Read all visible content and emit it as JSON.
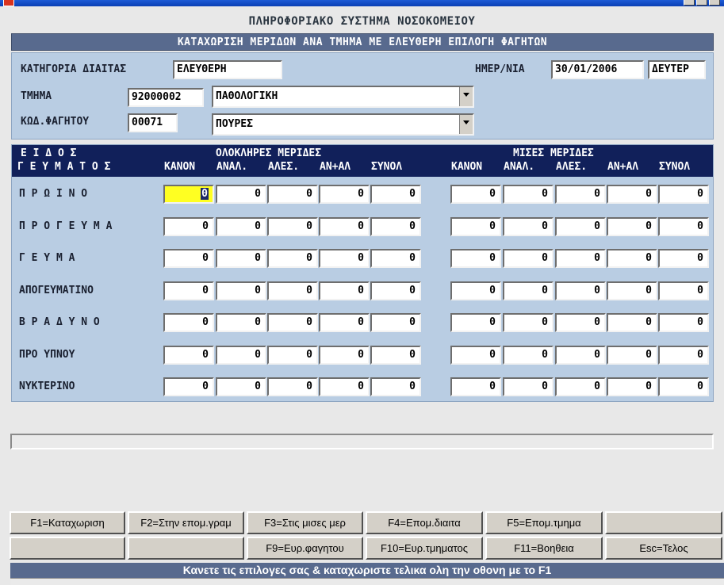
{
  "window": {
    "title": ""
  },
  "system_title": "ΠΛΗΡΟΦΟΡΙΑΚΟ ΣΥΣΤΗΜΑ ΝΟΣΟΚΟΜΕΙΟΥ",
  "form_title": "ΚΑΤΑΧΩΡΙΣΗ ΜΕΡΙΔΩΝ ΑΝΑ ΤΜΗΜΑ ΜΕ ΕΛΕΥΘΕΡΗ ΕΠΙΛΟΓΗ ΦΑΓΗΤΩΝ",
  "filters": {
    "diet_label": "ΚΑΤΗΓΟΡΙΑ ΔΙΑΙΤΑΣ",
    "diet_value": "ΕΛΕΥΘΕΡΗ",
    "date_label": "ΗΜΕΡ/ΝΙΑ",
    "date_value": "30/01/2006",
    "day_value": "ΔΕΥΤΕΡ",
    "dept_label": "ΤΜΗΜΑ",
    "dept_code": "92000002",
    "dept_name": "ΠΑΘΟΛΟΓΙΚΗ",
    "food_label": "ΚΩΔ.ΦΑΓΗΤΟΥ",
    "food_code": "00071",
    "food_name": "ΠΟΥΡΕΣ"
  },
  "grid": {
    "type_header_1": "Ε  Ι  Δ  Ο  Σ",
    "type_header_2": "Γ Ε Υ Μ Α Τ Ο Σ",
    "full_group": "ΟΛΟΚΛΗΡΕΣ  ΜΕΡΙΔΕΣ",
    "half_group": "ΜΙΣΕΣ  ΜΕΡΙΔΕΣ",
    "columns": [
      "ΚΑΝΟΝ",
      "ΑΝΑΛ.",
      "ΑΛΕΣ.",
      "ΑΝ+ΑΛ",
      "ΣΥΝΟΛ"
    ],
    "rows": [
      {
        "label": "Π Ρ Ω Ι Ν Ο",
        "full": [
          "0",
          "0",
          "0",
          "0",
          "0"
        ],
        "half": [
          "0",
          "0",
          "0",
          "0",
          "0"
        ]
      },
      {
        "label": "Π Ρ Ο Γ Ε Υ Μ Α",
        "full": [
          "0",
          "0",
          "0",
          "0",
          "0"
        ],
        "half": [
          "0",
          "0",
          "0",
          "0",
          "0"
        ]
      },
      {
        "label": "Γ Ε Υ Μ Α",
        "full": [
          "0",
          "0",
          "0",
          "0",
          "0"
        ],
        "half": [
          "0",
          "0",
          "0",
          "0",
          "0"
        ]
      },
      {
        "label": "ΑΠΟΓΕΥΜΑΤΙΝΟ",
        "full": [
          "0",
          "0",
          "0",
          "0",
          "0"
        ],
        "half": [
          "0",
          "0",
          "0",
          "0",
          "0"
        ]
      },
      {
        "label": "Β Ρ Α Δ Υ Ν Ο",
        "full": [
          "0",
          "0",
          "0",
          "0",
          "0"
        ],
        "half": [
          "0",
          "0",
          "0",
          "0",
          "0"
        ]
      },
      {
        "label": "ΠΡΟ ΥΠΝΟΥ",
        "full": [
          "0",
          "0",
          "0",
          "0",
          "0"
        ],
        "half": [
          "0",
          "0",
          "0",
          "0",
          "0"
        ]
      },
      {
        "label": "ΝΥΚΤΕΡΙΝΟ",
        "full": [
          "0",
          "0",
          "0",
          "0",
          "0"
        ],
        "half": [
          "0",
          "0",
          "0",
          "0",
          "0"
        ]
      }
    ]
  },
  "function_keys": {
    "row1": [
      "F1=Καταχωριση",
      "F2=Στην επομ.γραμ",
      "F3=Στις μισες μερ",
      "F4=Επομ.διαιτα",
      "F5=Επομ.τμημα",
      ""
    ],
    "row2": [
      "",
      "",
      "F9=Ευρ.φαγητου",
      "F10=Ευρ.τμηματος",
      "F11=Βοηθεια",
      "Esc=Τελος"
    ]
  },
  "hint": "Κανετε τις επιλογες σας & καταχωριστε τελικα ολη την οθονη με το F1",
  "colors": {
    "header_bar": "#586a8e",
    "panel": "#b9cde3",
    "grid_header": "#11205a",
    "active_cell": "#ffff22"
  }
}
